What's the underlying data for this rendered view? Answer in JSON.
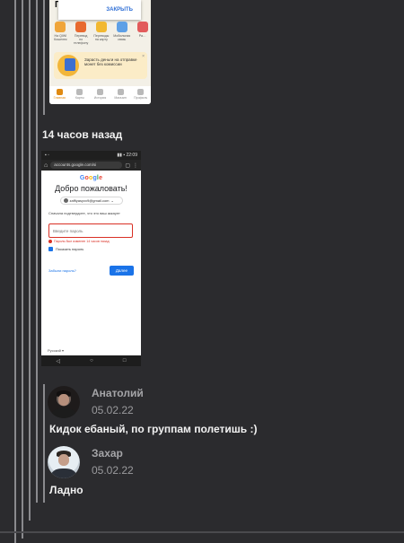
{
  "top_screenshot": {
    "partial_title": "П",
    "dialog_button": "ЗАКРЫТЬ",
    "quick_actions": [
      {
        "label": "На QIWI Кошелек",
        "color": "#f0a53a"
      },
      {
        "label": "Перевод по телефону",
        "color": "#e86a2e"
      },
      {
        "label": "Переводы на карту",
        "color": "#f2b830"
      },
      {
        "label": "Мобильная связь",
        "color": "#5ea0e6"
      },
      {
        "label": "Ра…",
        "color": "#e25b5b"
      }
    ],
    "promo_text": "Зарасть деньги на отправке монет без комиссии",
    "tabs": [
      "Главная",
      "Карты",
      "История",
      "Магазин",
      "Профиль"
    ]
  },
  "time_ago": "14 часов назад",
  "login_screenshot": {
    "status_left": "▪ ◦",
    "status_right": "▮▮ ▪ 22:09",
    "url": "accounts.google.com/si",
    "google_letters": [
      "G",
      "o",
      "o",
      "g",
      "l",
      "e"
    ],
    "welcome": "Добро пожаловать!",
    "account": "zaffiyasyxx9@gmail.com",
    "hint": "Сначала подтвердите, что это ваш аккаунт",
    "password_placeholder": "Введите пароль",
    "error_text": "Пароль был изменен 14 часов назад",
    "show_password": "Показать пароль",
    "forgot": "Забыли пароль?",
    "next": "Далее",
    "language": "Русский ▾"
  },
  "comments": [
    {
      "author": "Анатолий",
      "date": "05.02.22",
      "text": "Кидок ебаный, по группам полетишь :)"
    },
    {
      "author": "Захар",
      "date": "05.02.22",
      "text": "Ладно"
    }
  ]
}
